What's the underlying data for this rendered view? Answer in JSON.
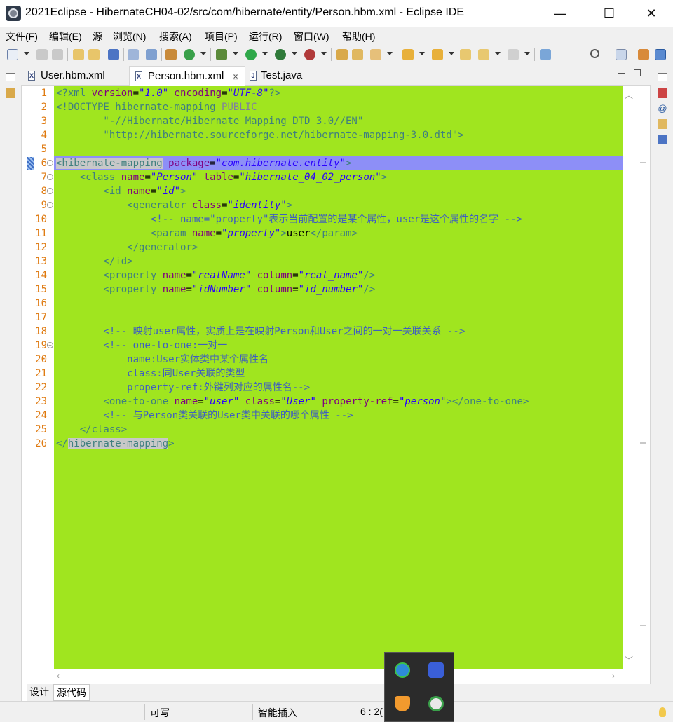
{
  "window": {
    "title": "2021Eclipse - HibernateCH04-02/src/com/hibernate/entity/Person.hbm.xml - Eclipse IDE",
    "minimize": "—",
    "maximize": "☐",
    "close": "✕"
  },
  "menu": [
    "文件(F)",
    "编辑(E)",
    "源",
    "浏览(N)",
    "搜索(A)",
    "项目(P)",
    "运行(R)",
    "窗口(W)",
    "帮助(H)"
  ],
  "tabs": [
    {
      "label": "User.hbm.xml",
      "icon": "X",
      "active": false
    },
    {
      "label": "Person.hbm.xml",
      "icon": "X",
      "active": true
    },
    {
      "label": "Test.java",
      "icon": "J",
      "active": false
    }
  ],
  "tab_close_glyph": "⊠",
  "line_numbers": [
    "1",
    "2",
    "3",
    "4",
    "5",
    "6",
    "7",
    "8",
    "9",
    "10",
    "11",
    "12",
    "13",
    "14",
    "15",
    "16",
    "17",
    "18",
    "19",
    "20",
    "21",
    "22",
    "23",
    "24",
    "25",
    "26"
  ],
  "code": {
    "l1": {
      "a": "<?xml ",
      "b": "version",
      "c": "=",
      "d": "\"1.0\"",
      "e": " ",
      "f": "encoding",
      "g": "=",
      "h": "\"UTF-8\"",
      "i": "?>"
    },
    "l2": {
      "a": "<!DOCTYPE hibernate-mapping ",
      "b": "PUBLIC"
    },
    "l3": "        \"-//Hibernate/Hibernate Mapping DTD 3.0//EN\"",
    "l4": "        \"http://hibernate.sourceforge.net/hibernate-mapping-3.0.dtd\">",
    "l6": {
      "a": "<hibernate-mapping",
      "b": " ",
      "c": "package",
      "d": "=",
      "e": "\"com.hibernate.entity\"",
      "f": ">"
    },
    "l7": {
      "a": "    <class ",
      "b": "name",
      "c": "=",
      "d": "\"Person\"",
      "e": " ",
      "f": "table",
      "g": "=",
      "h": "\"hibernate_04_02_person\"",
      "i": ">"
    },
    "l8": {
      "a": "        <id ",
      "b": "name",
      "c": "=",
      "d": "\"id\"",
      "e": ">"
    },
    "l9": {
      "a": "            <generator ",
      "b": "class",
      "c": "=",
      "d": "\"identity\"",
      "e": ">"
    },
    "l10": "                <!-- name=\"property\"表示当前配置的是某个属性，user是这个属性的名字 -->",
    "l11": {
      "a": "                <param ",
      "b": "name",
      "c": "=",
      "d": "\"property\"",
      "e": ">",
      "f": "user",
      "g": "</param>"
    },
    "l12": "            </generator>",
    "l13": "        </id>",
    "l14": {
      "a": "        <property ",
      "b": "name",
      "c": "=",
      "d": "\"realName\"",
      "e": " ",
      "f": "column",
      "g": "=",
      "h": "\"real_name\"",
      "i": "/>"
    },
    "l15": {
      "a": "        <property ",
      "b": "name",
      "c": "=",
      "d": "\"idNumber\"",
      "e": " ",
      "f": "column",
      "g": "=",
      "h": "\"id_number\"",
      "i": "/>"
    },
    "l18": "        <!-- 映射user属性，实质上是在映射Person和User之间的一对一关联关系 -->",
    "l19": "        <!-- one-to-one:一对一",
    "l20": "            name:User实体类中某个属性名",
    "l21": "            class:同User关联的类型",
    "l22": "            property-ref:外键列对应的属性名-->",
    "l23": {
      "a": "        <one-to-one ",
      "b": "name",
      "c": "=",
      "d": "\"user\"",
      "e": " ",
      "f": "class",
      "g": "=",
      "h": "\"User\"",
      "i": " ",
      "j": "property-ref",
      "k": "=",
      "l": "\"person\"",
      "m": "></one-to-one>"
    },
    "l24": "        <!-- 与Person类关联的User类中关联的哪个属性 -->",
    "l25": "    </class>",
    "l26": {
      "a": "</",
      "b": "hibernate-mapping",
      "c": ">"
    }
  },
  "mode_tabs": [
    "设计",
    "源代码"
  ],
  "status": {
    "writable": "可写",
    "insert_mode": "智能插入",
    "position": "6 : 2("
  },
  "colors": {
    "editor_bg": "#a0e51f",
    "current_line": "#8d8ff7",
    "line_number": "#df7a10"
  }
}
